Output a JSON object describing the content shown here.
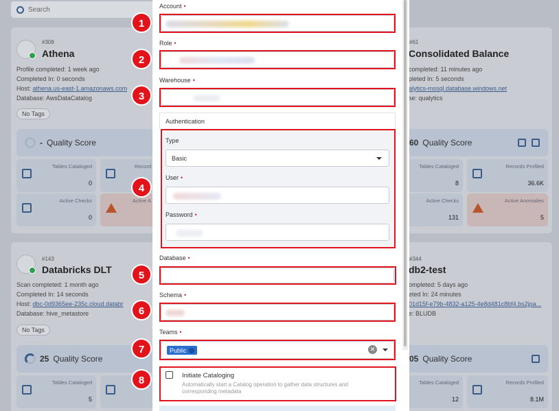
{
  "search": {
    "placeholder": "Search"
  },
  "cards": {
    "athena": {
      "number": "#308",
      "name": "Athena",
      "profile": "Profile completed:",
      "profile_time": "1 week ago",
      "completed_in": "Completed In:",
      "completed_val": "0 seconds",
      "host_label": "Host:",
      "host_val": "athena.us-east-1.amazonaws.com",
      "db_label": "Database:",
      "db_val": "AwsDataCatalog",
      "tag": "No Tags",
      "score_val": "-",
      "score_label": "Quality Score",
      "tables_label": "Tables Cataloged",
      "tables_val": "0",
      "records_label": "Record",
      "checks_label": "Active Checks",
      "checks_val": "0",
      "anom_label": "Active A"
    },
    "consolidated": {
      "number": "#61",
      "name": "Consolidated Balance",
      "profile": "completed:",
      "profile_time": "11 minutes ago",
      "completed_in": "pleted In:",
      "completed_val": "5 seconds",
      "host_val": "alytics-mssql.database.windows.net",
      "db_val": "se: qualytics",
      "score_val": "60",
      "score_label": "Quality Score",
      "tables_label": "Tables Cataloged",
      "tables_val": "8",
      "records_label": "Records Profiled",
      "records_val": "36.6K",
      "checks_label": "Active Checks",
      "checks_val": "131",
      "anom_label": "Active Anomalies",
      "anom_val": "5"
    },
    "databricks": {
      "number": "#143",
      "name": "Databricks DLT",
      "profile": "Scan completed:",
      "profile_time": "1 month ago",
      "completed_in": "Completed In:",
      "completed_val": "14 seconds",
      "host_label": "Host:",
      "host_val": "dbc-0d9365ee-235c.cloud.databr",
      "db_label": "Database:",
      "db_val": "hive_metastore",
      "tag": "No Tags",
      "score_val": "25",
      "score_label": "Quality Score",
      "tables_label": "Tables Cataloged",
      "tables_val": "5"
    },
    "db2": {
      "number": "#344",
      "name": "db2-test",
      "profile": "ompleted:",
      "profile_time": "5 days ago",
      "completed_in": "eted In:",
      "completed_val": "24 minutes",
      "host_val": "01d15f-e79b-4832-a125-4e8d481c8bf4.bs2jpa...",
      "db_val": "e: BLUDB",
      "score_val": "05",
      "score_label": "Quality Score",
      "tables_label": "Tables Cataloged",
      "tables_val": "12",
      "records_label": "Records Profiled",
      "records_val": "8.1M"
    }
  },
  "form": {
    "account_label": "Account",
    "role_label": "Role",
    "warehouse_label": "Warehouse",
    "auth_title": "Authentication",
    "type_label": "Type",
    "type_value": "Basic",
    "user_label": "User",
    "password_label": "Password",
    "database_label": "Database",
    "schema_label": "Schema",
    "teams_label": "Teams",
    "team_chip": "Public",
    "clear_symbol": "✕",
    "catalog_title": "Initiate Cataloging",
    "catalog_desc": "Automatically start a Catalog operation to gather data structures and corresponding metadata"
  },
  "badges": [
    "1",
    "2",
    "3",
    "4",
    "5",
    "6",
    "7",
    "8"
  ],
  "colors": {
    "highlight": "#e0141e",
    "badge": "#e3131b",
    "accent": "#2a6ecf"
  }
}
